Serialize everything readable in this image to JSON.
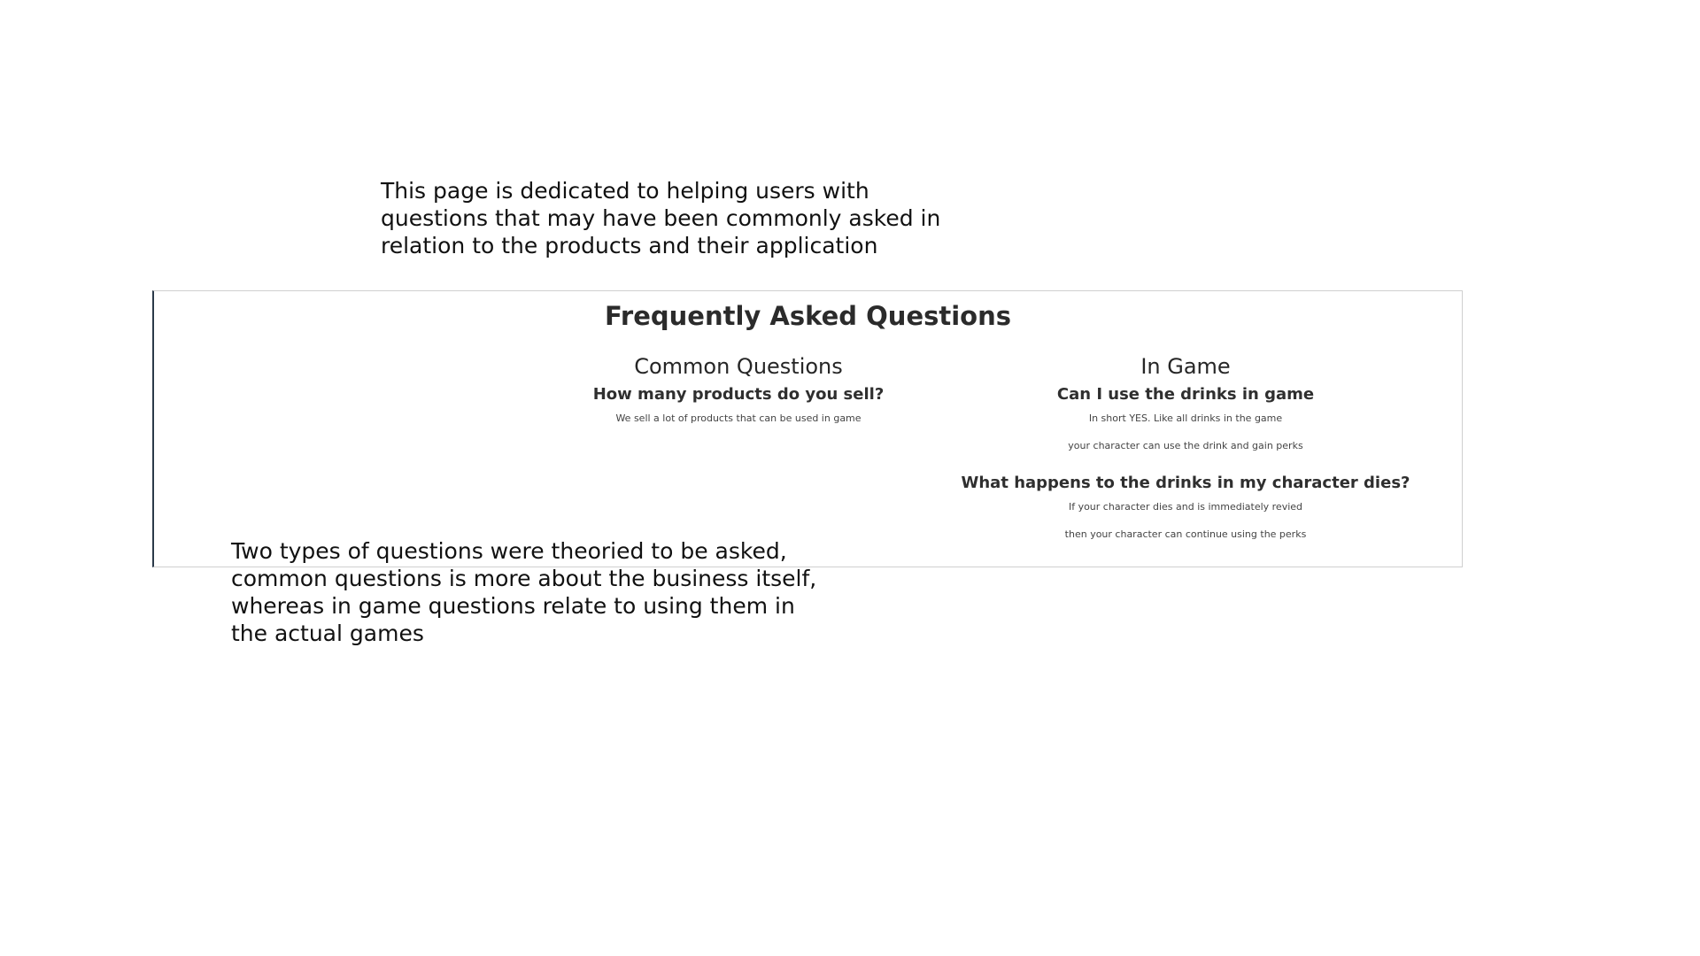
{
  "notes": {
    "intro": "This page is dedicated to helping users with questions that may have been commonly asked in relation to the products and their application",
    "types": "Two types of questions were theoried to be asked, common questions is more about the business itself, whereas in game questions relate to using them in the actual games"
  },
  "faq": {
    "title": "Frequently Asked Questions",
    "common": {
      "heading": "Common Questions",
      "items": [
        {
          "question": "How many products do you sell?",
          "answers": [
            "We sell a lot of products that can be used in game"
          ]
        }
      ]
    },
    "in_game": {
      "heading": "In Game",
      "items": [
        {
          "question": "Can I use the drinks in game",
          "answers": [
            "In short YES. Like all drinks in the game",
            "your character can use the drink and gain perks"
          ]
        },
        {
          "question": "What happens to the drinks in my character dies?",
          "answers": [
            "If your character dies and is immediately revied",
            "then your character can continue using the perks"
          ]
        }
      ]
    }
  }
}
